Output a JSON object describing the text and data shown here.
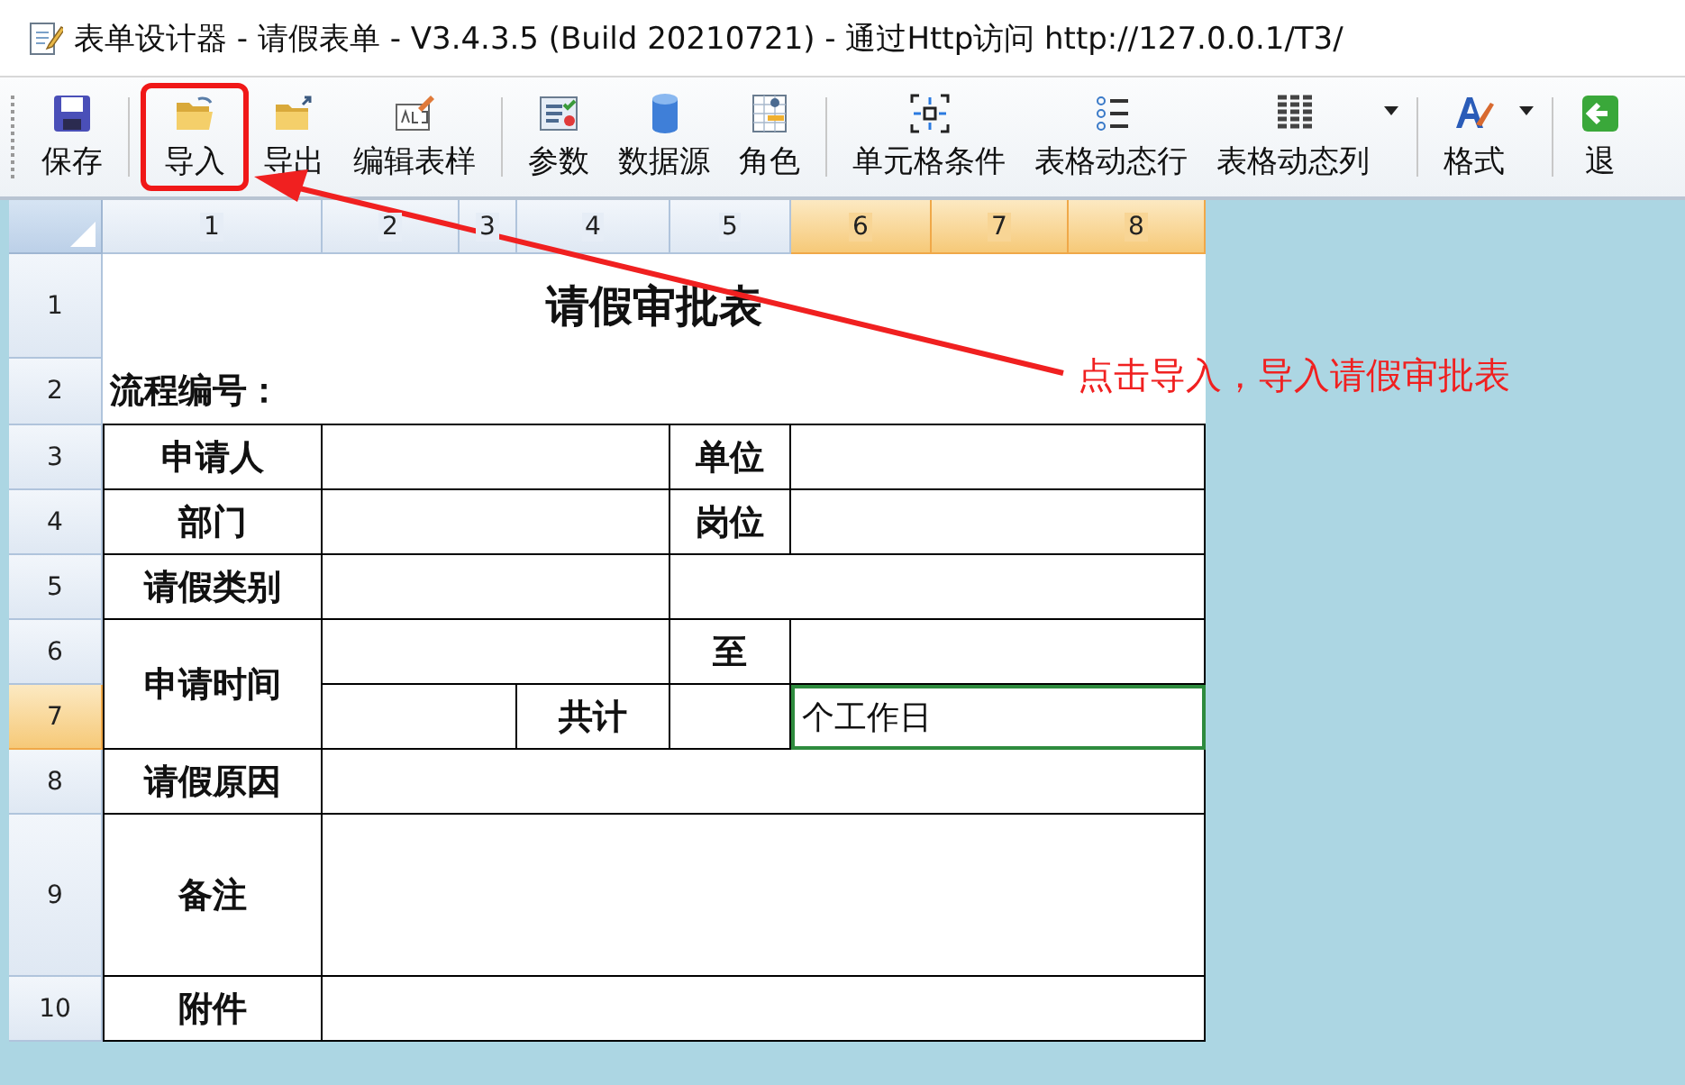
{
  "window": {
    "title": "表单设计器 - 请假表单 - V3.4.3.5 (Build 20210721) - 通过Http访问 http://127.0.0.1/T3/"
  },
  "toolbar_groups": [
    [
      {
        "label": "保存",
        "kind": "save",
        "highlighted": false,
        "has_menu": false
      }
    ],
    [
      {
        "label": "导入",
        "kind": "import",
        "highlighted": true,
        "has_menu": false
      },
      {
        "label": "导出",
        "kind": "export",
        "highlighted": false,
        "has_menu": false
      },
      {
        "label": "编辑表样",
        "kind": "edit",
        "highlighted": false,
        "has_menu": false
      }
    ],
    [
      {
        "label": "参数",
        "kind": "params",
        "highlighted": false,
        "has_menu": false
      },
      {
        "label": "数据源",
        "kind": "database",
        "highlighted": false,
        "has_menu": false
      },
      {
        "label": "角色",
        "kind": "role",
        "highlighted": false,
        "has_menu": false
      }
    ],
    [
      {
        "label": "单元格条件",
        "kind": "condition",
        "highlighted": false,
        "has_menu": false
      },
      {
        "label": "表格动态行",
        "kind": "rows",
        "highlighted": false,
        "has_menu": false
      },
      {
        "label": "表格动态列",
        "kind": "columns",
        "highlighted": false,
        "has_menu": true
      }
    ],
    [
      {
        "label": "格式",
        "kind": "format",
        "highlighted": false,
        "has_menu": true
      }
    ],
    [
      {
        "label": "退",
        "kind": "exit",
        "highlighted": false,
        "has_menu": false
      }
    ]
  ],
  "sheet": {
    "column_headers": [
      {
        "label": "1",
        "selected": false
      },
      {
        "label": "2",
        "selected": false
      },
      {
        "label": "3",
        "selected": false
      },
      {
        "label": "4",
        "selected": false
      },
      {
        "label": "5",
        "selected": false
      },
      {
        "label": "6",
        "selected": true
      },
      {
        "label": "7",
        "selected": true
      },
      {
        "label": "8",
        "selected": true
      }
    ],
    "row_headers": [
      {
        "label": "1",
        "selected": false
      },
      {
        "label": "2",
        "selected": false
      },
      {
        "label": "3",
        "selected": false
      },
      {
        "label": "4",
        "selected": false
      },
      {
        "label": "5",
        "selected": false
      },
      {
        "label": "6",
        "selected": false
      },
      {
        "label": "7",
        "selected": true
      },
      {
        "label": "8",
        "selected": false
      },
      {
        "label": "9",
        "selected": false
      },
      {
        "label": "10",
        "selected": false
      }
    ],
    "cells": [
      {
        "text": "请假审批表",
        "selected": false
      },
      {
        "text": "流程编号：",
        "selected": false
      },
      {
        "text": "申请人",
        "selected": false
      },
      {
        "text": "单位",
        "selected": false
      },
      {
        "text": "部门",
        "selected": false
      },
      {
        "text": "岗位",
        "selected": false
      },
      {
        "text": "请假类别",
        "selected": false
      },
      {
        "text": "申请时间",
        "selected": false
      },
      {
        "text": "至",
        "selected": false
      },
      {
        "text": "共计",
        "selected": false
      },
      {
        "text": "个工作日",
        "selected": true
      },
      {
        "text": "请假原因",
        "selected": false
      },
      {
        "text": "备注",
        "selected": false
      },
      {
        "text": "附件",
        "selected": false
      }
    ]
  },
  "annotation": {
    "text": "点击导入，导入请假审批表"
  }
}
